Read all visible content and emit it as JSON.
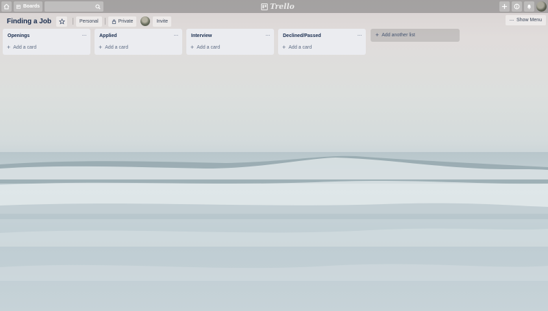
{
  "header": {
    "boards_label": "Boards",
    "search": {
      "value": "",
      "placeholder": ""
    },
    "logo_text": "Trello"
  },
  "board": {
    "title": "Finding a Job",
    "team_label": "Personal",
    "visibility_label": "Private",
    "invite_label": "Invite",
    "show_menu_label": "Show Menu"
  },
  "lists": [
    {
      "title": "Openings",
      "add_card_label": "Add a card"
    },
    {
      "title": "Applied",
      "add_card_label": "Add a card"
    },
    {
      "title": "Interview",
      "add_card_label": "Add a card"
    },
    {
      "title": "Declined/Passed",
      "add_card_label": "Add a card"
    }
  ],
  "add_list_label": "Add another list",
  "colors": {
    "header_bg": "#787878",
    "list_bg": "#ebecf0",
    "title_text": "#172b4d"
  },
  "icons": {
    "home": "home-icon",
    "boards": "boards-icon",
    "search": "search-icon",
    "create": "plus-icon",
    "info": "info-icon",
    "notifications": "bell-icon",
    "star": "star-icon",
    "private": "lock-icon",
    "menu": "ellipsis-icon"
  }
}
